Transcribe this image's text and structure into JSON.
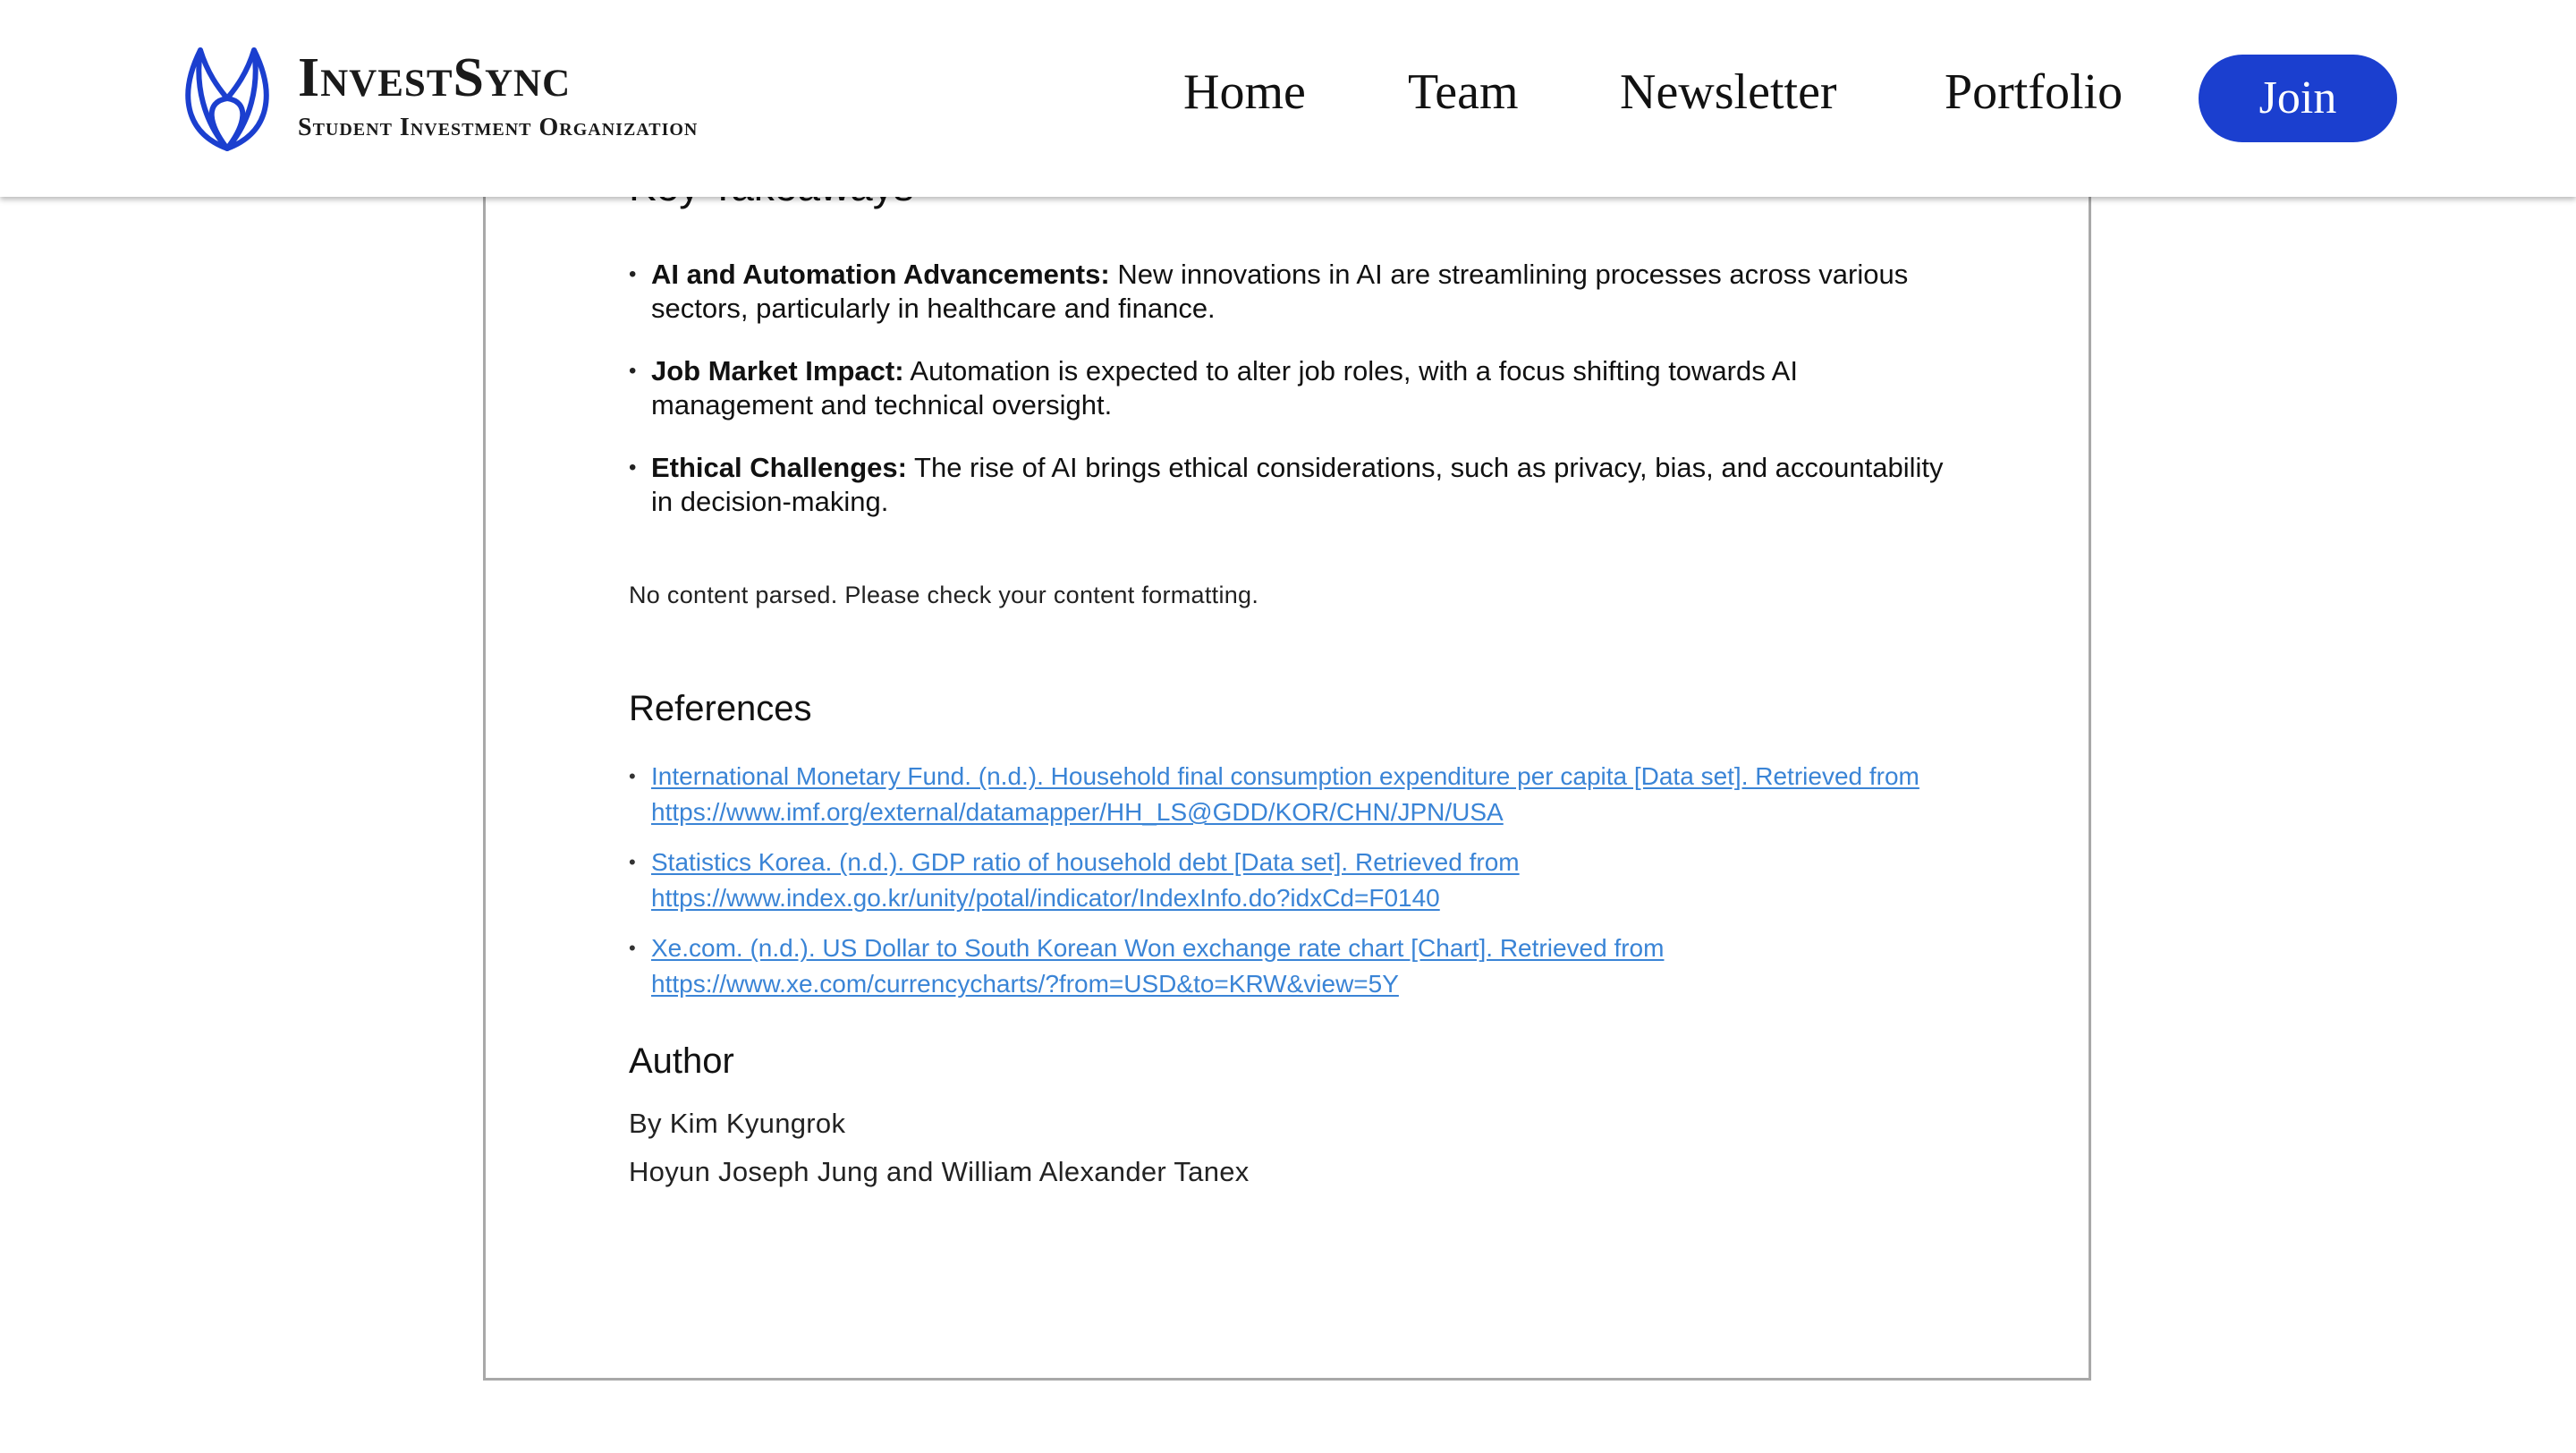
{
  "header": {
    "brand": "InvestSync",
    "tagline": "Student Investment Organization",
    "nav": [
      "Home",
      "Team",
      "Newsletter",
      "Portfolio"
    ],
    "join_label": "Join",
    "brand_color": "#1b3fcf"
  },
  "article": {
    "key_takeaways_heading": "Key Takeaways",
    "takeaways": [
      {
        "title": "AI and Automation Advancements:",
        "text": "New innovations in AI are streamlining processes across various sectors, particularly in healthcare and finance."
      },
      {
        "title": "Job Market Impact:",
        "text": "Automation is expected to alter job roles, with a focus shifting towards AI management and technical oversight."
      },
      {
        "title": "Ethical Challenges:",
        "text": "The rise of AI brings ethical considerations, such as privacy, bias, and accountability in decision-making."
      }
    ],
    "no_content_notice": "No content parsed. Please check your content formatting.",
    "references_heading": "References",
    "references": [
      "International Monetary Fund. (n.d.). Household final consumption expenditure per capita [Data set]. Retrieved from https://www.imf.org/external/datamapper/HH_LS@GDD/KOR/CHN/JPN/USA",
      "Statistics Korea. (n.d.). GDP ratio of household debt [Data set]. Retrieved from https://www.index.go.kr/unity/potal/indicator/IndexInfo.do?idxCd=F0140",
      "Xe.com. (n.d.). US Dollar to South Korean Won exchange rate chart [Chart]. Retrieved from https://www.xe.com/currencycharts/?from=USD&to=KRW&view=5Y"
    ],
    "author_heading": "Author",
    "author_byline": "By Kim Kyungrok",
    "author_contributors": "Hoyun Joseph Jung and William Alexander Tanex",
    "link_color": "#3a84d6"
  }
}
